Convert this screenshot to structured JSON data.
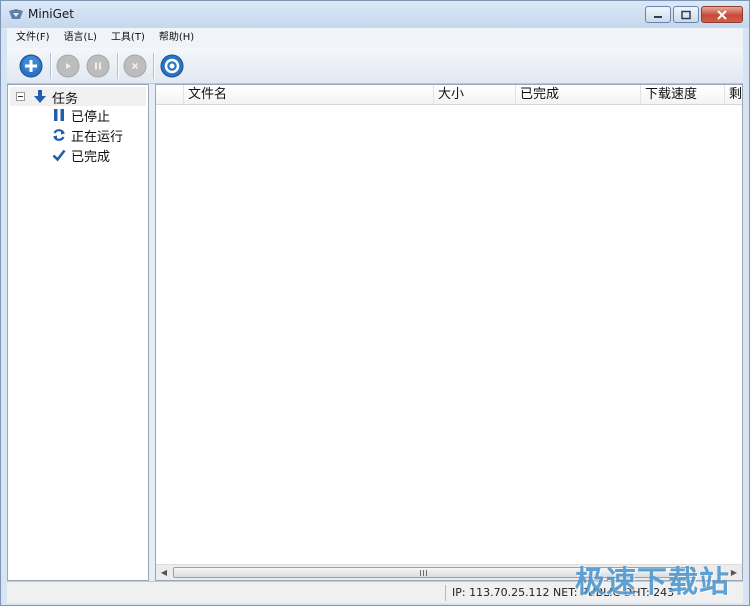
{
  "window": {
    "title": "MiniGet"
  },
  "menu": [
    "文件(F)",
    "语言(L)",
    "工具(T)",
    "帮助(H)"
  ],
  "toolbar": {
    "buttons": [
      {
        "name": "add-task-button",
        "icon": "plus-icon",
        "enabled": true
      },
      {
        "name": "start-button",
        "icon": "play-icon",
        "enabled": false
      },
      {
        "name": "pause-button",
        "icon": "pause-icon",
        "enabled": false
      },
      {
        "name": "delete-button",
        "icon": "close-icon",
        "enabled": false
      },
      {
        "name": "settings-button",
        "icon": "ring-icon",
        "enabled": true
      }
    ]
  },
  "tree": {
    "root": {
      "label": "任务",
      "icon": "arrow-down-icon"
    },
    "children": [
      {
        "label": "已停止",
        "icon": "pause-icon"
      },
      {
        "label": "正在运行",
        "icon": "refresh-icon"
      },
      {
        "label": "已完成",
        "icon": "check-icon"
      }
    ]
  },
  "grid": {
    "columns": [
      "文件名",
      "大小",
      "已完成",
      "下载速度",
      "剩"
    ]
  },
  "status": {
    "text": "IP: 113.70.25.112  NET: PUBLIC   DHT: 243"
  },
  "watermark": "极速下载站",
  "colors": {
    "accent": "#1f6fbf",
    "disabled": "#b8b8b8",
    "window_frame": "#d6e4f3"
  }
}
